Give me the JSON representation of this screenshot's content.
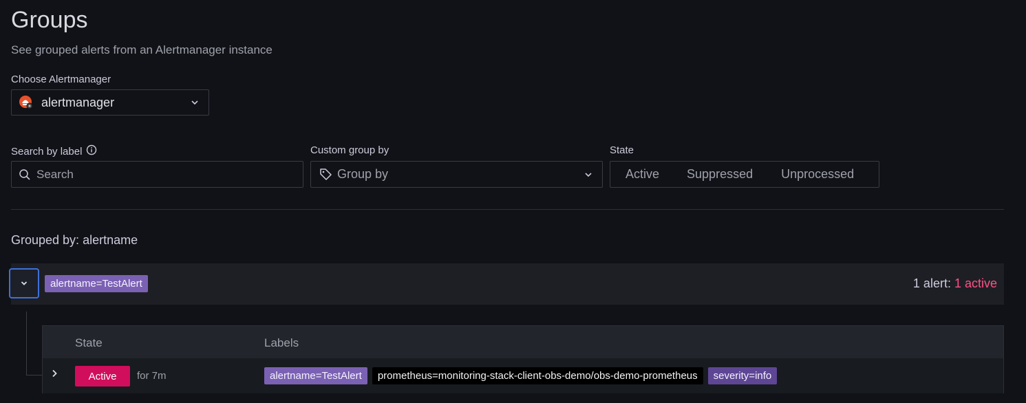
{
  "page": {
    "title": "Groups",
    "subtitle": "See grouped alerts from an Alertmanager instance"
  },
  "alertmanager": {
    "label": "Choose Alertmanager",
    "selected": "alertmanager"
  },
  "filters": {
    "search_label": "Search by label",
    "search_placeholder": "Search",
    "group_label": "Custom group by",
    "group_placeholder": "Group by",
    "state_label": "State",
    "state_options": [
      "Active",
      "Suppressed",
      "Unprocessed"
    ]
  },
  "grouped_by": "Grouped by: alertname",
  "group": {
    "tag": "alertname=TestAlert",
    "summary_prefix": "1 alert: ",
    "summary_active": "1 active"
  },
  "table": {
    "headers": {
      "state": "State",
      "labels": "Labels"
    },
    "rows": [
      {
        "state": "Active",
        "duration": "for 7m",
        "labels": [
          "alertname=TestAlert",
          "prometheus=monitoring-stack-client-obs-demo/obs-demo-prometheus",
          "severity=info"
        ]
      }
    ]
  },
  "colors": {
    "background": "#111217",
    "accent_blue": "#3d71d9",
    "active_red": "#d10e5c",
    "active_text": "#ff5286",
    "tag_purple": "#7b61b3"
  }
}
